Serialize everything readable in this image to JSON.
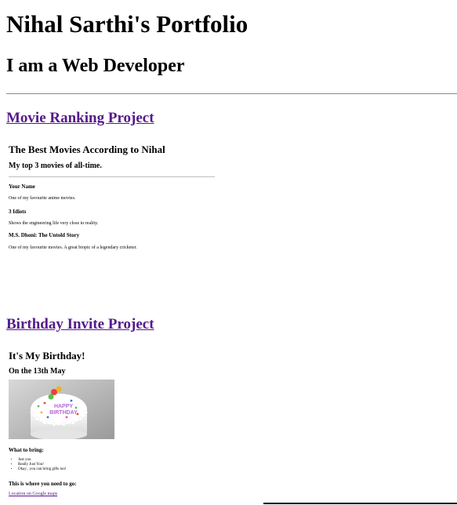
{
  "header": {
    "title": "Nihal Sarthi's Portfolio",
    "subtitle": "I am a Web Developer"
  },
  "projects": [
    {
      "link_label": "Movie Ranking Project",
      "preview": {
        "heading": "The Best Movies According to Nihal",
        "subheading": "My top 3 movies of all-time.",
        "movies": [
          {
            "title": "Your Name",
            "description": "One of my favourite anime movies."
          },
          {
            "title": "3 Idiots",
            "description": "Shows the engineering life very close to reality."
          },
          {
            "title": "M.S. Dhoni: The Untold Story",
            "description": "One of my favourite movies. A great biopic of a legendary cricketer."
          }
        ]
      }
    },
    {
      "link_label": "Birthday Invite Project",
      "preview": {
        "heading": "It's My Birthday!",
        "date": "On the 13th May",
        "cake_text": "HAPPY BIRTHDAY",
        "bring_heading": "What to bring:",
        "bring_items": [
          "Just you",
          "Really Just You!",
          "Okay , you can bring gifts too!"
        ],
        "location_heading": "This is where you need to go:",
        "location_link": "Location on Google maps"
      }
    }
  ]
}
